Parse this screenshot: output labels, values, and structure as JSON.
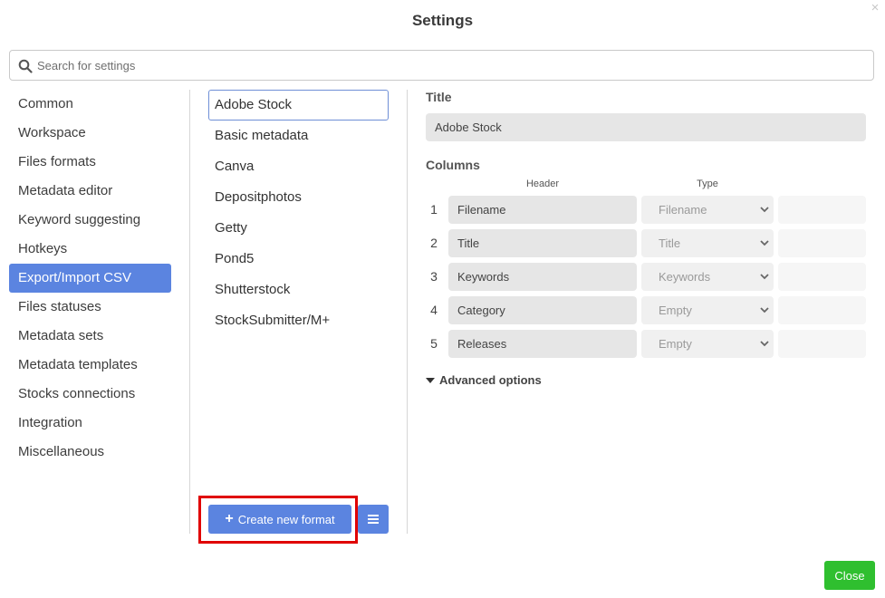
{
  "dialog": {
    "title": "Settings",
    "close_glyph": "×"
  },
  "search": {
    "placeholder": "Search for settings",
    "value": ""
  },
  "nav": [
    {
      "label": "Common"
    },
    {
      "label": "Workspace"
    },
    {
      "label": "Files formats"
    },
    {
      "label": "Metadata editor"
    },
    {
      "label": "Keyword suggesting"
    },
    {
      "label": "Hotkeys"
    },
    {
      "label": "Export/Import CSV",
      "active": true
    },
    {
      "label": "Files statuses"
    },
    {
      "label": "Metadata sets"
    },
    {
      "label": "Metadata templates"
    },
    {
      "label": "Stocks connections"
    },
    {
      "label": "Integration"
    },
    {
      "label": "Miscellaneous"
    }
  ],
  "formats": [
    {
      "label": "Adobe Stock",
      "selected": true
    },
    {
      "label": "Basic metadata"
    },
    {
      "label": "Canva"
    },
    {
      "label": "Depositphotos"
    },
    {
      "label": "Getty"
    },
    {
      "label": "Pond5"
    },
    {
      "label": "Shutterstock"
    },
    {
      "label": "StockSubmitter/M+"
    }
  ],
  "buttons": {
    "create_label": "Create new format",
    "create_icon": "+",
    "close_label": "Close"
  },
  "detail": {
    "title_label": "Title",
    "title_value": "Adobe Stock",
    "columns_label": "Columns",
    "header_col": "Header",
    "type_col": "Type",
    "rows": [
      {
        "num": "1",
        "header": "Filename",
        "type": "Filename"
      },
      {
        "num": "2",
        "header": "Title",
        "type": "Title"
      },
      {
        "num": "3",
        "header": "Keywords",
        "type": "Keywords"
      },
      {
        "num": "4",
        "header": "Category",
        "type": "Empty"
      },
      {
        "num": "5",
        "header": "Releases",
        "type": "Empty"
      }
    ],
    "advanced_label": "Advanced options"
  },
  "colors": {
    "accent": "#5b84e0",
    "close_green": "#2fbf2f",
    "highlight_red": "#e00000"
  },
  "icons": {
    "search": "search-icon",
    "menu": "hamburger-icon",
    "close": "close-icon",
    "dropdown": "chevron-down-icon",
    "advanced": "caret-down-icon"
  }
}
